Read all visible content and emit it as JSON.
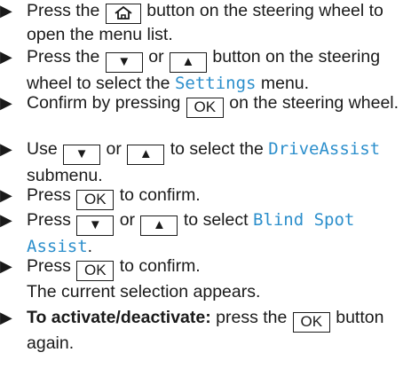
{
  "glyphs": {
    "bullet": "▶",
    "down": "▼",
    "up": "▲"
  },
  "keys": {
    "ok": "OK",
    "home_icon": "home-icon"
  },
  "colors": {
    "menu_text": "#2c8fcc",
    "body_text": "#1a1a1a"
  },
  "steps": [
    {
      "a": "Press the",
      "b": "button on the steering wheel to open the menu list."
    },
    {
      "a": "Press the",
      "or": "or",
      "b": "button on the steering wheel to select the",
      "menu": "Settings",
      "end": "menu."
    },
    {
      "a": "Confirm by pressing",
      "b": "on the steering wheel."
    },
    {
      "a": "Use",
      "or": "or",
      "b": "to select the",
      "menu": "DriveAssist",
      "end": "submenu."
    },
    {
      "a": "Press",
      "b": "to confirm."
    },
    {
      "a": "Press",
      "or": "or",
      "b": "to select",
      "menu": "Blind Spot Assist",
      "end": "."
    },
    {
      "a": "Press",
      "b": "to confirm.",
      "c": "The current selection appears."
    },
    {
      "bold": "To activate/deactivate:",
      "a": "press the",
      "b": "button again."
    }
  ]
}
